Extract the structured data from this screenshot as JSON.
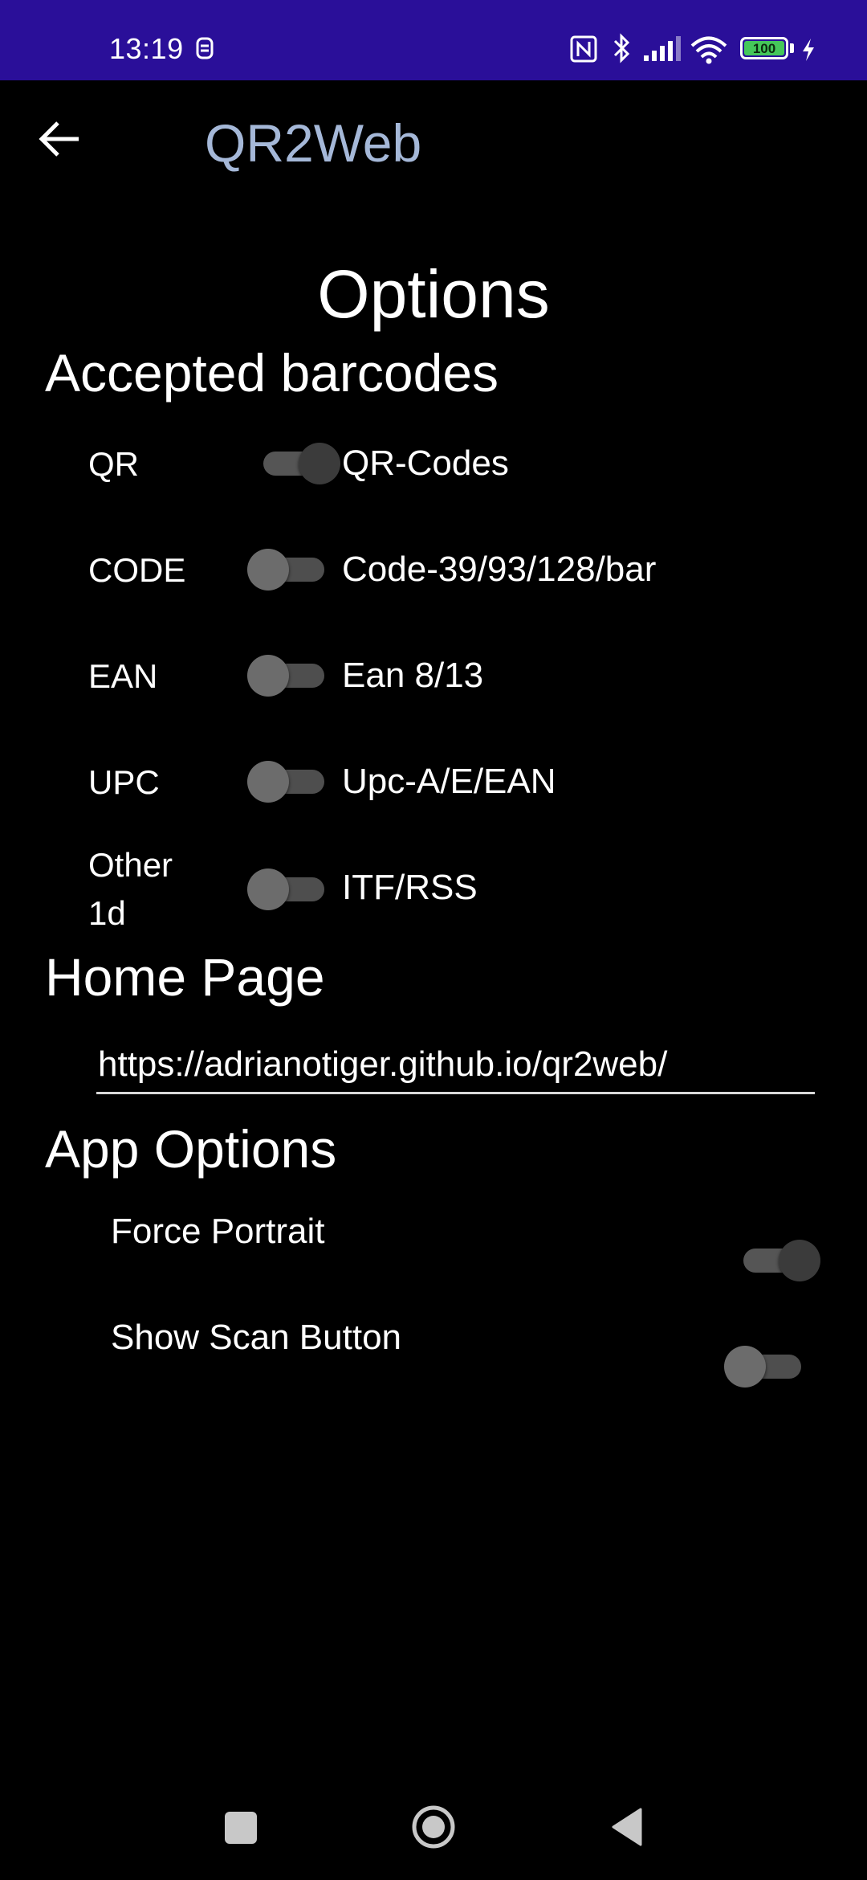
{
  "status_bar": {
    "time": "13:19",
    "battery_level": "100",
    "colors": {
      "background": "#2a0f99",
      "battery": "#45c75a"
    },
    "icons": [
      "usb-debug-icon",
      "nfc-icon",
      "bluetooth-icon",
      "signal-icon",
      "wifi-icon",
      "battery-icon",
      "charging-icon"
    ]
  },
  "app_bar": {
    "title": "QR2Web",
    "title_color": "#a5b8d8",
    "back_icon": "arrow-left-icon"
  },
  "page": {
    "title": "Options"
  },
  "barcodes": {
    "heading": "Accepted barcodes",
    "items": [
      {
        "name": "QR",
        "desc": "QR-Codes",
        "enabled": true
      },
      {
        "name": "CODE",
        "desc": "Code-39/93/128/bar",
        "enabled": false
      },
      {
        "name": "EAN",
        "desc": "Ean 8/13",
        "enabled": false
      },
      {
        "name": "UPC",
        "desc": "Upc-A/E/EAN",
        "enabled": false
      },
      {
        "name": "Other 1d",
        "desc": "ITF/RSS",
        "enabled": false
      }
    ]
  },
  "home_page": {
    "heading": "Home Page",
    "url": "https://adrianotiger.github.io/qr2web/"
  },
  "app_options": {
    "heading": "App Options",
    "items": [
      {
        "label": "Force Portrait",
        "enabled": true
      },
      {
        "label": "Show Scan Button",
        "enabled": false
      }
    ]
  },
  "nav_bar": {
    "icons": [
      "recents-square-icon",
      "home-circle-icon",
      "back-triangle-icon"
    ]
  }
}
